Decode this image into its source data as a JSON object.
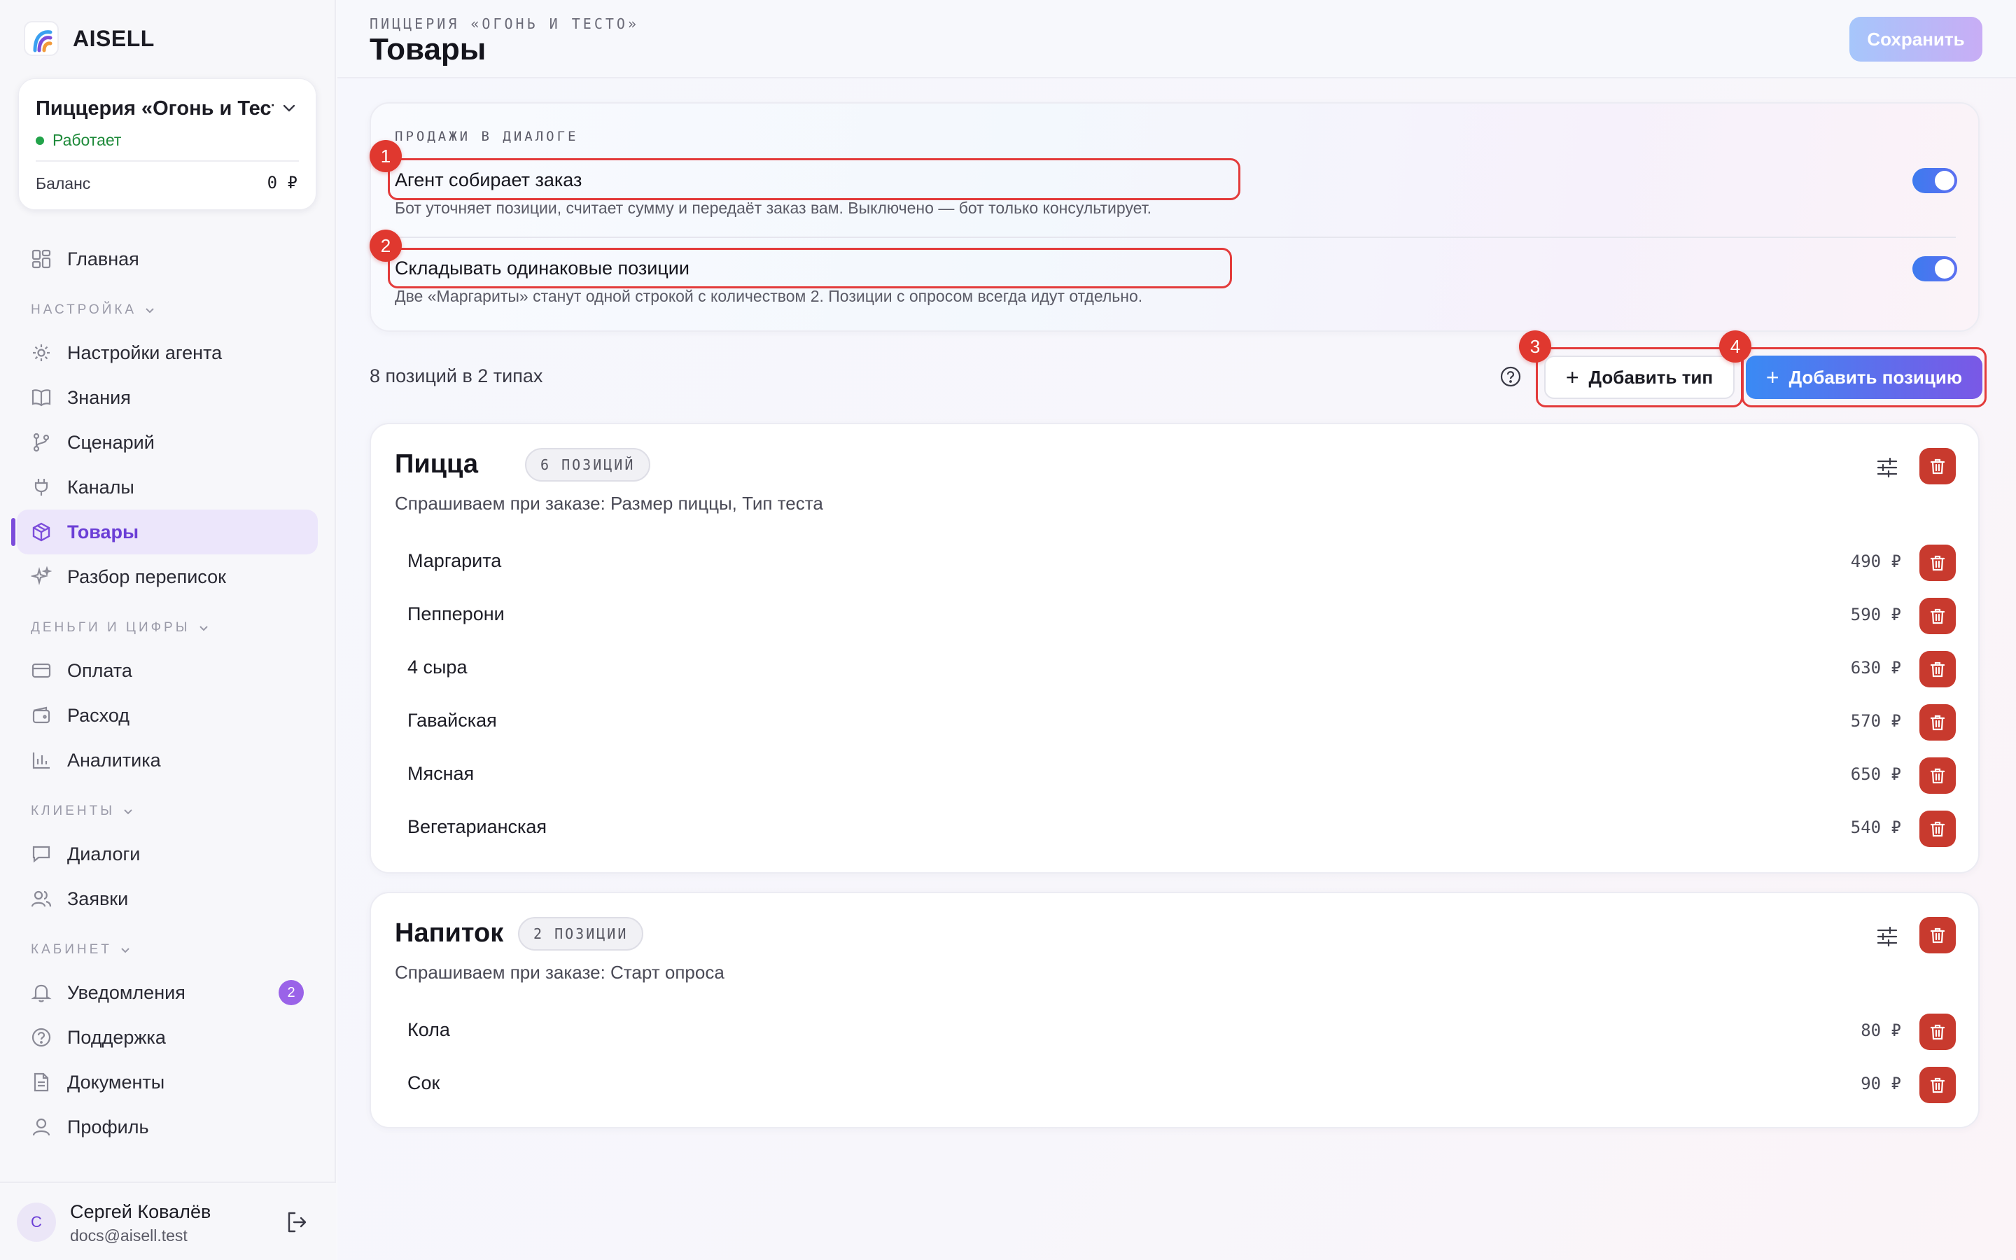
{
  "brand": {
    "name": "AISELL"
  },
  "org": {
    "name": "Пиццерия «Огонь и Тест...",
    "status": "Работает",
    "balance_label": "Баланс",
    "balance_value": "0 ₽"
  },
  "nav": {
    "main": [
      {
        "label": "Главная",
        "icon": "dashboard-icon"
      }
    ],
    "sections": [
      {
        "title": "НАСТРОЙКА",
        "items": [
          {
            "label": "Настройки агента",
            "icon": "gear-icon"
          },
          {
            "label": "Знания",
            "icon": "book-icon"
          },
          {
            "label": "Сценарий",
            "icon": "branch-icon"
          },
          {
            "label": "Каналы",
            "icon": "plug-icon"
          },
          {
            "label": "Товары",
            "icon": "box-icon",
            "active": true
          },
          {
            "label": "Разбор переписок",
            "icon": "sparkle-icon"
          }
        ]
      },
      {
        "title": "ДЕНЬГИ И ЦИФРЫ",
        "items": [
          {
            "label": "Оплата",
            "icon": "card-icon"
          },
          {
            "label": "Расход",
            "icon": "wallet-icon"
          },
          {
            "label": "Аналитика",
            "icon": "chart-icon"
          }
        ]
      },
      {
        "title": "КЛИЕНТЫ",
        "items": [
          {
            "label": "Диалоги",
            "icon": "chat-icon"
          },
          {
            "label": "Заявки",
            "icon": "users-icon"
          }
        ]
      },
      {
        "title": "КАБИНЕТ",
        "items": [
          {
            "label": "Уведомления",
            "icon": "bell-icon",
            "badge": "2"
          },
          {
            "label": "Поддержка",
            "icon": "help-icon"
          },
          {
            "label": "Документы",
            "icon": "document-icon"
          },
          {
            "label": "Профиль",
            "icon": "user-icon"
          }
        ]
      }
    ]
  },
  "user": {
    "initial": "С",
    "name": "Сергей Ковалёв",
    "email": "docs@aisell.test"
  },
  "header": {
    "breadcrumb": "ПИЦЦЕРИЯ «ОГОНЬ И ТЕСТО»",
    "title": "Товары",
    "save_label": "Сохранить"
  },
  "sales": {
    "heading": "ПРОДАЖИ В ДИАЛОГЕ",
    "settings": [
      {
        "title": "Агент собирает заказ",
        "description": "Бот уточняет позиции, считает сумму и передаёт заказ вам. Выключено — бот только консультирует.",
        "enabled": true,
        "marker": "1"
      },
      {
        "title": "Складывать одинаковые позиции",
        "description": "Две «Маргариты» станут одной строкой с количеством 2. Позиции с опросом всегда идут отдельно.",
        "enabled": true,
        "marker": "2"
      }
    ]
  },
  "toolbar": {
    "summary": "8 позиций в 2 типах",
    "add_type_label": "Добавить тип",
    "add_type_marker": "3",
    "add_position_label": "Добавить позицию",
    "add_position_marker": "4"
  },
  "categories": [
    {
      "title": "Пицца",
      "badge": "6 ПОЗИЦИЙ",
      "subtitle": "Спрашиваем при заказе: Размер пиццы, Тип теста",
      "items": [
        {
          "name": "Маргарита",
          "price": "490 ₽"
        },
        {
          "name": "Пепперони",
          "price": "590 ₽"
        },
        {
          "name": "4 сыра",
          "price": "630 ₽"
        },
        {
          "name": "Гавайская",
          "price": "570 ₽"
        },
        {
          "name": "Мясная",
          "price": "650 ₽"
        },
        {
          "name": "Вегетарианская",
          "price": "540 ₽"
        }
      ]
    },
    {
      "title": "Напиток",
      "badge": "2 ПОЗИЦИИ",
      "subtitle": "Спрашиваем при заказе: Старт опроса",
      "items": [
        {
          "name": "Кола",
          "price": "80 ₽"
        },
        {
          "name": "Сок",
          "price": "90 ₽"
        }
      ]
    }
  ],
  "colors": {
    "accent": "#7c4ddb",
    "danger": "#c83a2e",
    "toggle_on": "#3d7bef",
    "highlight": "#e33b3b"
  }
}
